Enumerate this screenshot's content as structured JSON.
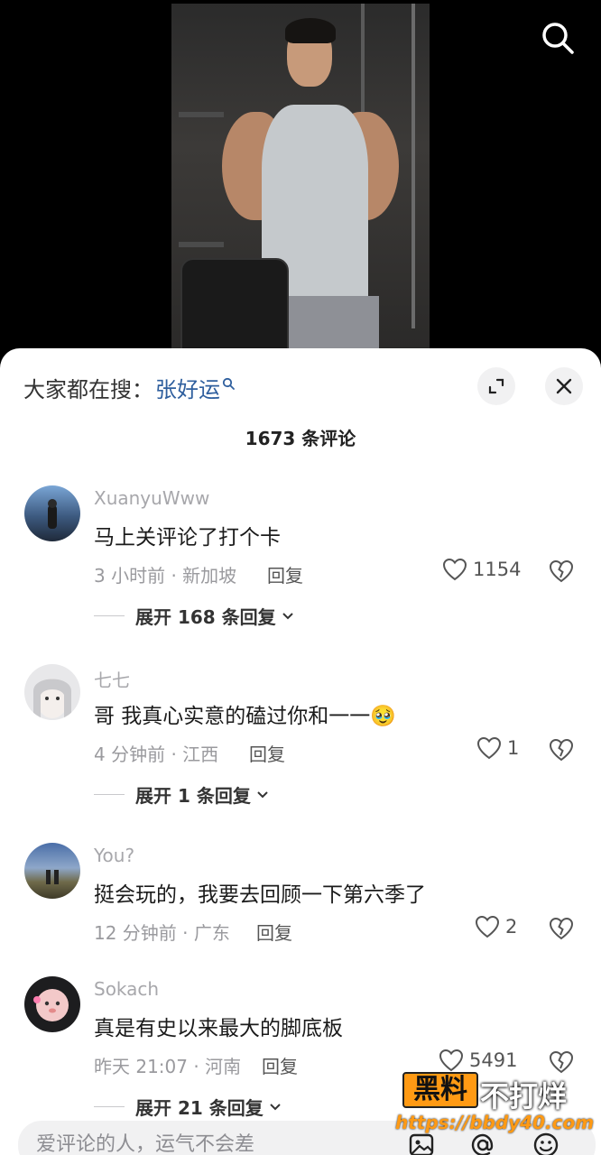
{
  "video": {
    "search_icon": "search-icon"
  },
  "sheet": {
    "hot_search_prefix": "大家都在搜：",
    "hot_search_keyword": "张好运",
    "comment_count": "1673 条评论",
    "expand_icon": "expand-icon",
    "close_icon": "close-icon"
  },
  "comments": [
    {
      "username": "XuanyuWww",
      "text": "马上关评论了打个卡",
      "meta": "3 小时前 · 新加坡",
      "reply_label": "回复",
      "likes": "1154",
      "expand_label": "展开 168 条回复"
    },
    {
      "username": "七七",
      "text": "哥 我真心实意的磕过你和一一🥹",
      "meta": "4 分钟前 · 江西",
      "reply_label": "回复",
      "likes": "1",
      "expand_label": "展开 1 条回复"
    },
    {
      "username": "You?",
      "text": "挺会玩的，我要去回顾一下第六季了",
      "meta": "12 分钟前 · 广东",
      "reply_label": "回复",
      "likes": "2"
    },
    {
      "username": "Sokach",
      "text": "真是有史以来最大的脚底板",
      "meta": "昨天 21:07 · 河南",
      "reply_label": "回复",
      "likes": "5491",
      "expand_label": "展开 21 条回复"
    }
  ],
  "input": {
    "placeholder": "爱评论的人，运气不会差",
    "icons": [
      "image-icon",
      "mention-icon",
      "emoji-icon"
    ]
  },
  "watermark": {
    "box_text": "黑料",
    "tail_text": "不打烊",
    "url": "https://bbdy40.com"
  }
}
